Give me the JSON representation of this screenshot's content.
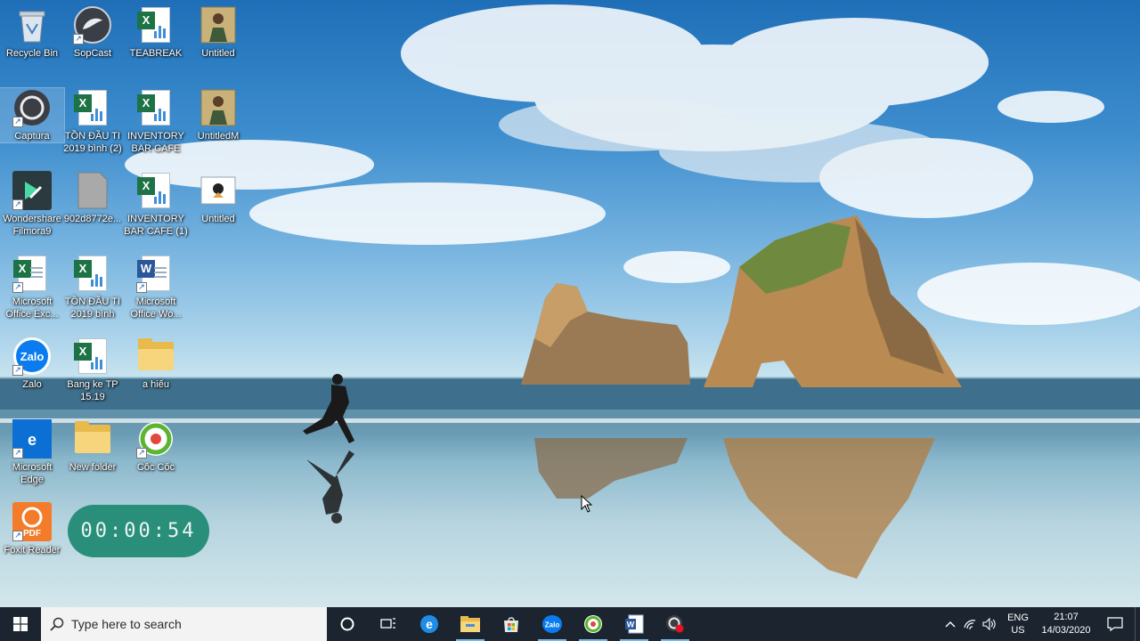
{
  "desktop": {
    "icons": [
      {
        "label": "Recycle Bin",
        "icon": "recycle-bin-icon"
      },
      {
        "label": "SopCast",
        "icon": "sopcast-icon"
      },
      {
        "label": "TEABREAK",
        "icon": "excel-file-icon"
      },
      {
        "label": "Untitled",
        "icon": "image-file-icon"
      },
      {
        "label": "Captura",
        "icon": "captura-icon"
      },
      {
        "label": "TỒN ĐẦU TI 2019 bình (2)",
        "icon": "excel-file-icon"
      },
      {
        "label": "INVENTORY BAR CAFE",
        "icon": "excel-file-icon"
      },
      {
        "label": "UntitledM",
        "icon": "image-file-icon"
      },
      {
        "label": "Wondershare Filmora9",
        "icon": "filmora-icon"
      },
      {
        "label": "902d8772e...",
        "icon": "file-icon"
      },
      {
        "label": "INVENTORY BAR CAFE (1)",
        "icon": "excel-file-icon"
      },
      {
        "label": "Untitled",
        "icon": "image-file-icon"
      },
      {
        "label": "Microsoft Office Exc...",
        "icon": "excel-app-icon"
      },
      {
        "label": "TỒN ĐẦU TI 2019 bình",
        "icon": "excel-file-icon"
      },
      {
        "label": "Microsoft Office Wo...",
        "icon": "word-app-icon"
      },
      {
        "label": "Zalo",
        "icon": "zalo-icon"
      },
      {
        "label": "Bang ke TP 15.19",
        "icon": "excel-file-icon"
      },
      {
        "label": "a hiếu",
        "icon": "folder-icon"
      },
      {
        "label": "Microsoft Edge",
        "icon": "edge-icon"
      },
      {
        "label": "New folder",
        "icon": "folder-icon"
      },
      {
        "label": "Cốc Cốc",
        "icon": "coccoc-icon"
      },
      {
        "label": "Foxit Reader",
        "icon": "foxit-icon"
      }
    ]
  },
  "timer": {
    "value": "00:00:54"
  },
  "taskbar": {
    "search_placeholder": "Type here to search",
    "apps": [
      "Cortana",
      "Task View",
      "Microsoft Edge",
      "File Explorer",
      "Microsoft Store",
      "Zalo",
      "Cốc Cốc",
      "Microsoft Word",
      "Captura"
    ],
    "language": {
      "line1": "ENG",
      "line2": "US"
    },
    "clock": {
      "time": "21:07",
      "date": "14/03/2020"
    }
  },
  "colors": {
    "taskbar": "#1c2430",
    "timer": "#1f8a73",
    "accent": "#76b9ed"
  }
}
